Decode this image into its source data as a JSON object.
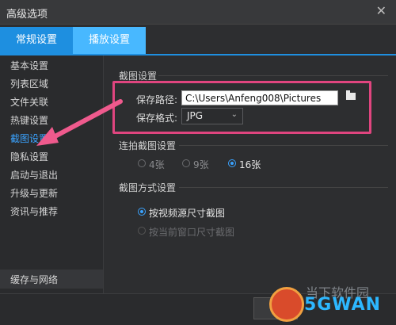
{
  "window": {
    "title": "高级选项",
    "close_glyph": "✕"
  },
  "tabs": [
    {
      "label": "常规设置",
      "active": true
    },
    {
      "label": "播放设置",
      "active": false
    }
  ],
  "sidebar": {
    "items": [
      {
        "label": "基本设置"
      },
      {
        "label": "列表区域"
      },
      {
        "label": "文件关联"
      },
      {
        "label": "热键设置"
      },
      {
        "label": "截图设置",
        "active": true
      },
      {
        "label": "隐私设置"
      },
      {
        "label": "启动与退出"
      },
      {
        "label": "升级与更新"
      },
      {
        "label": "资讯与推荐"
      }
    ],
    "bottom_item": {
      "label": "缓存与网络"
    }
  },
  "screenshot_settings": {
    "section_title": "截图设置",
    "save_path_label": "保存路径:",
    "save_path_value": "C:\\Users\\Anfeng008\\Pictures",
    "save_format_label": "保存格式:",
    "save_format_value": "JPG"
  },
  "burst_settings": {
    "section_title": "连拍截图设置",
    "options": [
      {
        "label": "4张",
        "checked": false
      },
      {
        "label": "9张",
        "checked": false
      },
      {
        "label": "16张",
        "checked": true
      }
    ]
  },
  "capture_mode": {
    "section_title": "截图方式设置",
    "options": [
      {
        "label": "按视频源尺寸截图",
        "checked": true,
        "disabled": false
      },
      {
        "label": "按当前窗口尺寸截图",
        "checked": false,
        "disabled": true
      }
    ]
  },
  "footer": {
    "ok_fragment": "定"
  },
  "watermark": {
    "brand": "5GWAN",
    "overlay": "当下软件园"
  },
  "colors": {
    "accent": "#1e8fe0",
    "highlight_box": "#e0457f",
    "arrow": "#ef5a8d"
  }
}
